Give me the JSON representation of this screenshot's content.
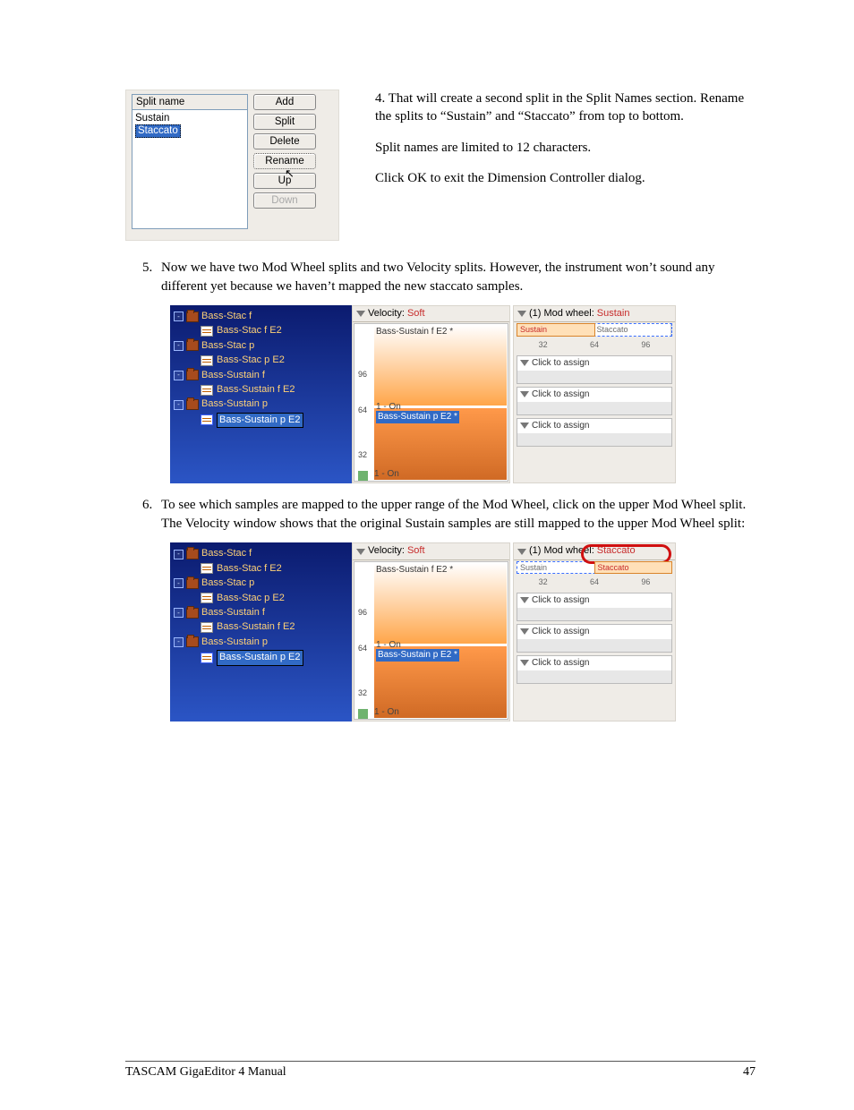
{
  "split_panel": {
    "header": "Split name",
    "items": [
      "Sustain",
      "Staccato"
    ],
    "selected_index": 1,
    "buttons": {
      "add": "Add",
      "split": "Split",
      "delete": "Delete",
      "rename": "Rename",
      "up": "Up",
      "down": "Down"
    }
  },
  "body": {
    "step4_a": "4. That will create a second split in the Split Names section. Rename the splits to “Sustain” and  “Staccato” from top to bottom.",
    "step4_b": "Split names are limited to 12 characters.",
    "step4_c": "Click OK to exit the Dimension Controller dialog.",
    "step5": "Now we have two Mod Wheel splits and two Velocity splits.  However, the instrument won’t sound any different yet because we haven’t mapped the new staccato samples.",
    "step6": "To see which samples are mapped to the upper range of the Mod Wheel, click on the upper Mod Wheel split.  The Velocity window shows that the original Sustain samples are still mapped to the upper Mod Wheel split:"
  },
  "tree": {
    "items": [
      {
        "label": "Bass-Stac f",
        "child": "Bass-Stac f E2"
      },
      {
        "label": "Bass-Stac p",
        "child": "Bass-Stac p E2"
      },
      {
        "label": "Bass-Sustain f",
        "child": "Bass-Sustain f E2"
      },
      {
        "label": "Bass-Sustain p",
        "child": "Bass-Sustain p E2",
        "selected": true
      }
    ]
  },
  "velocity": {
    "title_a": "Velocity:",
    "title_b": "Soft",
    "zone_top": "Bass-Sustain f E2 *",
    "zone_mid_hdr": "1 - On",
    "zone_mid": "Bass-Sustain p E2 *",
    "bottom": "1 - On",
    "ticks": {
      "t96": "96",
      "t64": "64",
      "t32": "32"
    }
  },
  "mod1": {
    "title_a": "(1) Mod wheel:",
    "title_b": "Sustain",
    "half_l": "Sustain",
    "half_r": "Staccato",
    "num_32": "32",
    "num_64": "64",
    "num_96": "96",
    "assign": "Click to assign"
  },
  "mod2": {
    "title_a": "(1) Mod wheel:",
    "title_b": "Staccato",
    "half_l": "Sustain",
    "half_r": "Staccato",
    "num_32": "32",
    "num_64": "64",
    "num_96": "96",
    "assign": "Click to assign"
  },
  "footer": {
    "left": "TASCAM GigaEditor 4 Manual",
    "right": "47"
  }
}
